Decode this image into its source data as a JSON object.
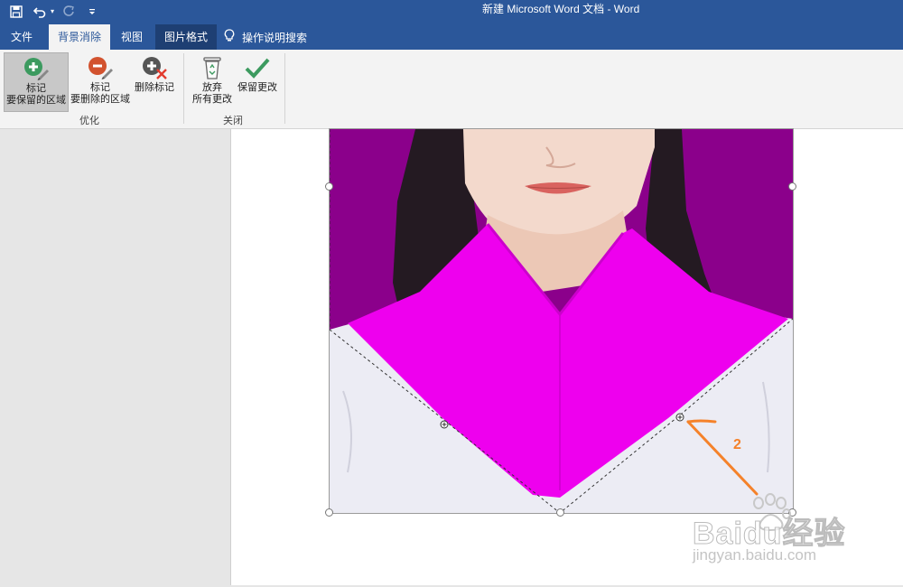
{
  "title_bar": {
    "document_title": "新建 Microsoft Word 文档  -  Word",
    "quick_access": [
      {
        "icon": "save-icon"
      },
      {
        "icon": "undo-icon"
      },
      {
        "icon": "redo-icon",
        "disabled": true
      },
      {
        "icon": "customize-qat-icon"
      }
    ]
  },
  "tabs": [
    {
      "label": "文件"
    },
    {
      "label": "背景消除",
      "active": true
    },
    {
      "label": "视图"
    },
    {
      "label": "图片格式",
      "contextual": true
    }
  ],
  "tell_me": {
    "label": "操作说明搜索",
    "icon": "lightbulb-icon"
  },
  "ribbon": {
    "groups": {
      "optimize": {
        "label": "优化",
        "buttons": {
          "mark_keep": {
            "line1": "标记",
            "line2": "要保留的区域",
            "icon": "plus-pencil-icon",
            "pressed": true
          },
          "mark_remove": {
            "line1": "标记",
            "line2": "要删除的区域",
            "icon": "minus-pencil-icon"
          },
          "delete_mark": {
            "line1": "删除标记",
            "icon": "delete-mark-icon"
          }
        }
      },
      "close": {
        "label": "关闭",
        "buttons": {
          "discard": {
            "line1": "放弃",
            "line2": "所有更改",
            "icon": "recycle-bin-icon"
          },
          "keep": {
            "line1": "保留更改",
            "icon": "checkmark-icon"
          }
        }
      }
    }
  },
  "annotation": {
    "label": "2",
    "color": "#f5822a"
  },
  "watermark": {
    "line1": "Baidu经验",
    "line2": "jingyan.baidu.com"
  },
  "colors": {
    "title_blue": "#2b579a",
    "removed_area": "#8b008b",
    "marked_magenta": "#ee00ee",
    "annotation_orange": "#f5822a"
  }
}
